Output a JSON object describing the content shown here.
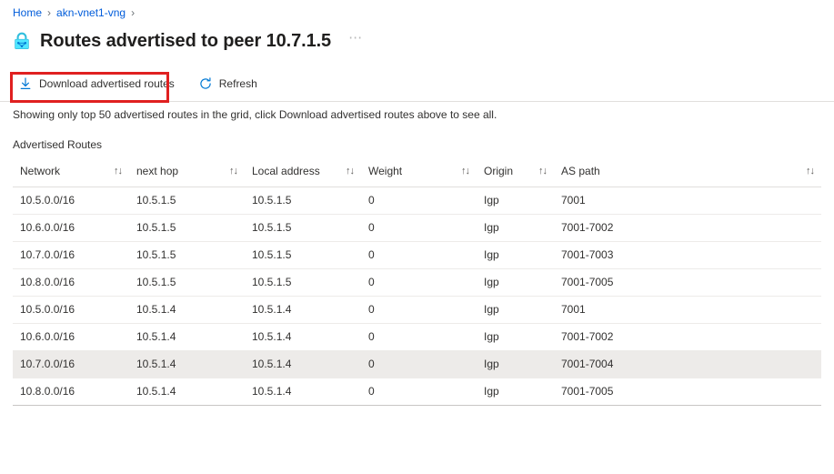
{
  "breadcrumb": {
    "items": [
      {
        "label": "Home",
        "is_link": true
      },
      {
        "label": "akn-vnet1-vng",
        "is_link": true
      }
    ],
    "separator": "›",
    "trailing_separator": "›"
  },
  "header": {
    "icon": "vpn-gateway-lock-icon",
    "title": "Routes advertised to peer 10.7.1.5",
    "more_menu": "⋯"
  },
  "toolbar": {
    "download_label": "Download advertised routes",
    "download_icon": "download-icon",
    "refresh_label": "Refresh",
    "refresh_icon": "refresh-icon",
    "highlight_color": "#e02020"
  },
  "notice": {
    "text": "Showing only top 50 advertised routes in the grid, click Download advertised routes above to see all."
  },
  "grid": {
    "label": "Advertised Routes",
    "sort_glyph": "↑↓",
    "columns": [
      {
        "key": "network",
        "label": "Network",
        "sortable": true
      },
      {
        "key": "next_hop",
        "label": "next hop",
        "sortable": true
      },
      {
        "key": "local_address",
        "label": "Local address",
        "sortable": true
      },
      {
        "key": "weight",
        "label": "Weight",
        "sortable": true
      },
      {
        "key": "origin",
        "label": "Origin",
        "sortable": true
      },
      {
        "key": "as_path",
        "label": "AS path",
        "sortable": true
      }
    ],
    "rows": [
      {
        "network": "10.5.0.0/16",
        "next_hop": "10.5.1.5",
        "local_address": "10.5.1.5",
        "weight": "0",
        "origin": "Igp",
        "as_path": "7001",
        "selected": false
      },
      {
        "network": "10.6.0.0/16",
        "next_hop": "10.5.1.5",
        "local_address": "10.5.1.5",
        "weight": "0",
        "origin": "Igp",
        "as_path": "7001-7002",
        "selected": false
      },
      {
        "network": "10.7.0.0/16",
        "next_hop": "10.5.1.5",
        "local_address": "10.5.1.5",
        "weight": "0",
        "origin": "Igp",
        "as_path": "7001-7003",
        "selected": false
      },
      {
        "network": "10.8.0.0/16",
        "next_hop": "10.5.1.5",
        "local_address": "10.5.1.5",
        "weight": "0",
        "origin": "Igp",
        "as_path": "7001-7005",
        "selected": false
      },
      {
        "network": "10.5.0.0/16",
        "next_hop": "10.5.1.4",
        "local_address": "10.5.1.4",
        "weight": "0",
        "origin": "Igp",
        "as_path": "7001",
        "selected": false
      },
      {
        "network": "10.6.0.0/16",
        "next_hop": "10.5.1.4",
        "local_address": "10.5.1.4",
        "weight": "0",
        "origin": "Igp",
        "as_path": "7001-7002",
        "selected": false
      },
      {
        "network": "10.7.0.0/16",
        "next_hop": "10.5.1.4",
        "local_address": "10.5.1.4",
        "weight": "0",
        "origin": "Igp",
        "as_path": "7001-7004",
        "selected": true
      },
      {
        "network": "10.8.0.0/16",
        "next_hop": "10.5.1.4",
        "local_address": "10.5.1.4",
        "weight": "0",
        "origin": "Igp",
        "as_path": "7001-7005",
        "selected": false
      }
    ]
  },
  "colors": {
    "link": "#015cda",
    "accent": "#0078d4",
    "text": "#323130",
    "row_selected": "#edebe9",
    "border": "#e1dfdd"
  }
}
